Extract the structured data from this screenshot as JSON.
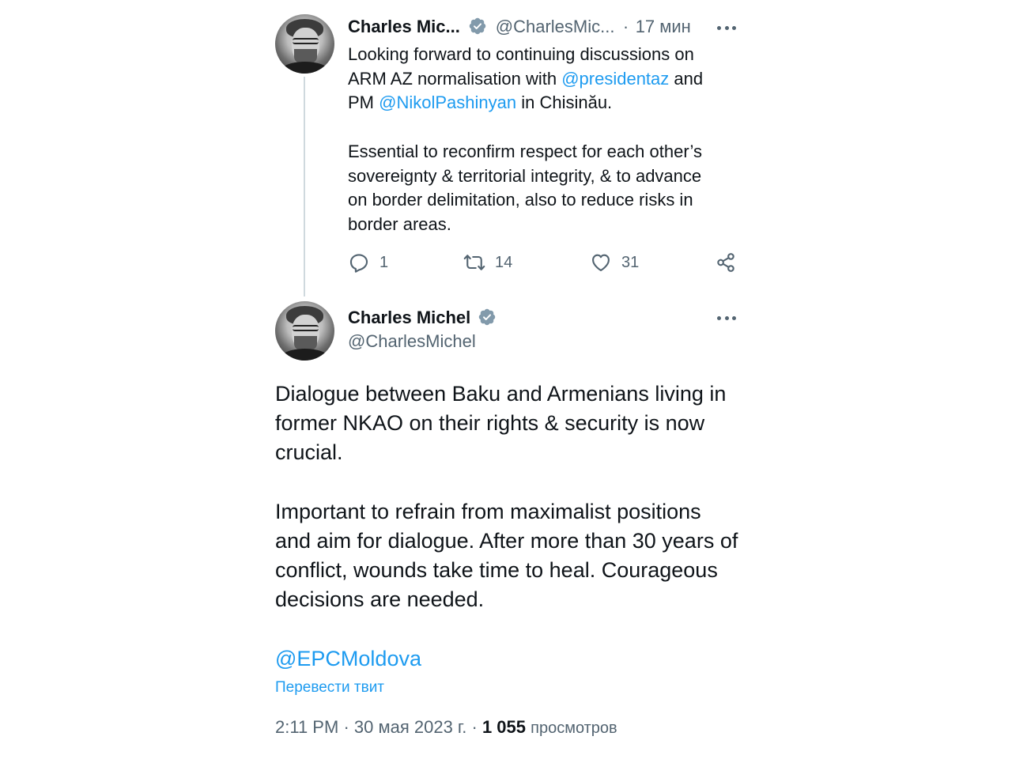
{
  "parent_tweet": {
    "author_name": "Charles Mic...",
    "handle": "@CharlesMic...",
    "separator": "·",
    "time": "17 мин",
    "lines": [
      [
        {
          "t": "Looking forward to continuing discussions on",
          "m": false
        }
      ],
      [
        {
          "t": "ARM AZ normalisation with ",
          "m": false
        },
        {
          "t": "@presidentaz",
          "m": true
        },
        {
          "t": " and",
          "m": false
        }
      ],
      [
        {
          "t": "PM ",
          "m": false
        },
        {
          "t": "@NikolPashinyan",
          "m": true
        },
        {
          "t": " in Chisinău.",
          "m": false
        }
      ],
      [
        {
          "t": "",
          "m": false
        }
      ],
      [
        {
          "t": "Essential to reconfirm respect for each other’s",
          "m": false
        }
      ],
      [
        {
          "t": "sovereignty & territorial integrity, & to advance",
          "m": false
        }
      ],
      [
        {
          "t": "on border delimitation, also to reduce risks in",
          "m": false
        }
      ],
      [
        {
          "t": "border areas.",
          "m": false
        }
      ]
    ],
    "stats": {
      "replies": "1",
      "retweets": "14",
      "likes": "31"
    },
    "icons": [
      "reply-icon",
      "retweet-icon",
      "like-icon",
      "share-icon",
      "more-icon",
      "verified-icon"
    ]
  },
  "main_tweet": {
    "author_name": "Charles Michel",
    "handle": "@CharlesMichel",
    "lines": [
      [
        {
          "t": "Dialogue between Baku and Armenians living in",
          "m": false
        }
      ],
      [
        {
          "t": "former NKAO on their rights & security is now",
          "m": false
        }
      ],
      [
        {
          "t": "crucial.",
          "m": false
        }
      ],
      [
        {
          "t": "",
          "m": false
        }
      ],
      [
        {
          "t": "Important to refrain from maximalist positions",
          "m": false
        }
      ],
      [
        {
          "t": "and aim for dialogue. After more than 30 years of",
          "m": false
        }
      ],
      [
        {
          "t": "conflict, wounds take time to heal. Courageous",
          "m": false
        }
      ],
      [
        {
          "t": "decisions are needed.",
          "m": false
        }
      ],
      [
        {
          "t": "",
          "m": false
        }
      ],
      [
        {
          "t": "@EPCMoldova",
          "m": true
        }
      ]
    ],
    "translate_label": "Перевести твит",
    "time": "2:11 PM",
    "date": "30 мая 2023 г.",
    "separator": "·",
    "views_count": "1 055",
    "views_label": "просмотров"
  },
  "colors": {
    "link": "#1d9bf0",
    "secondary": "#536471",
    "text": "#0f1419",
    "thread_line": "#cfd9de"
  }
}
